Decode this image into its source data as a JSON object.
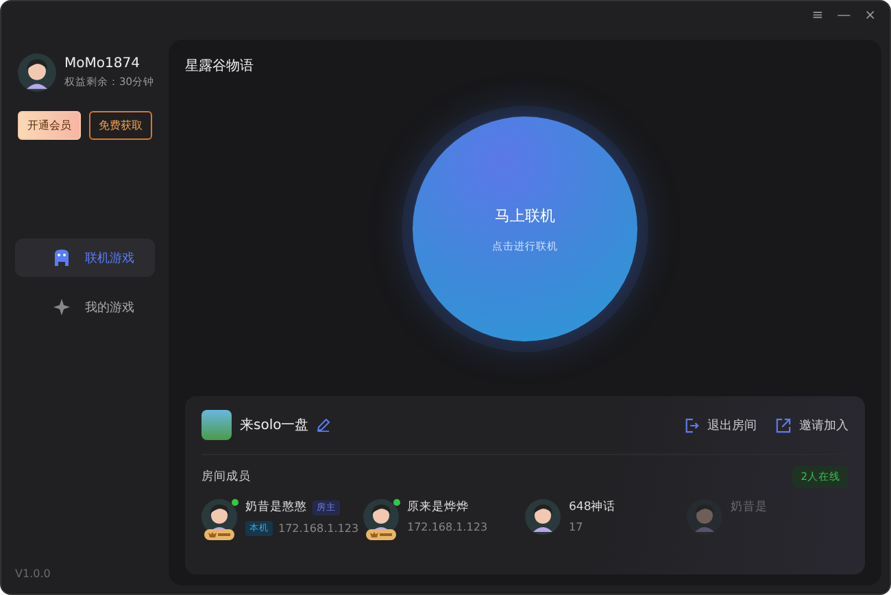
{
  "window_controls": [
    "≡",
    "—",
    "×"
  ],
  "user": {
    "name": "MoMo1874",
    "subtitle": "权益剩余：30分钟"
  },
  "buttons": [
    {
      "label": "开通会员",
      "kind": "primary"
    },
    {
      "label": "免费获取",
      "kind": "outline"
    }
  ],
  "sidebar": {
    "items": [
      {
        "label": "联机游戏",
        "selected": true,
        "kind": "gamepad"
      },
      {
        "label": "我的游戏",
        "selected": false,
        "kind": "sparkle"
      }
    ]
  },
  "version": "V1.0.0",
  "game_title": "星露谷物语",
  "connect_button": {
    "label": "马上联机",
    "hint": "点击进行联机"
  },
  "room": {
    "name": "来solo一盘",
    "actions": [
      {
        "label": "退出房间",
        "kind": "exit"
      },
      {
        "label": "邀请加入",
        "kind": "share"
      }
    ],
    "members_label": "房间成员",
    "online_count": "2人在线",
    "members": [
      {
        "name": "奶昔是憨憨",
        "online": true,
        "svip": true,
        "faded": false,
        "host_tag": "房主",
        "local_tag": "本机",
        "ip": "172.168.1.123"
      },
      {
        "name": "原来是烨烨",
        "online": true,
        "svip": true,
        "faded": false,
        "ip": "172.168.1.123"
      },
      {
        "name": "648神话",
        "online": false,
        "svip": false,
        "faded": false,
        "ip": "17"
      },
      {
        "name": "奶昔是",
        "online": false,
        "svip": false,
        "faded": true
      }
    ]
  }
}
